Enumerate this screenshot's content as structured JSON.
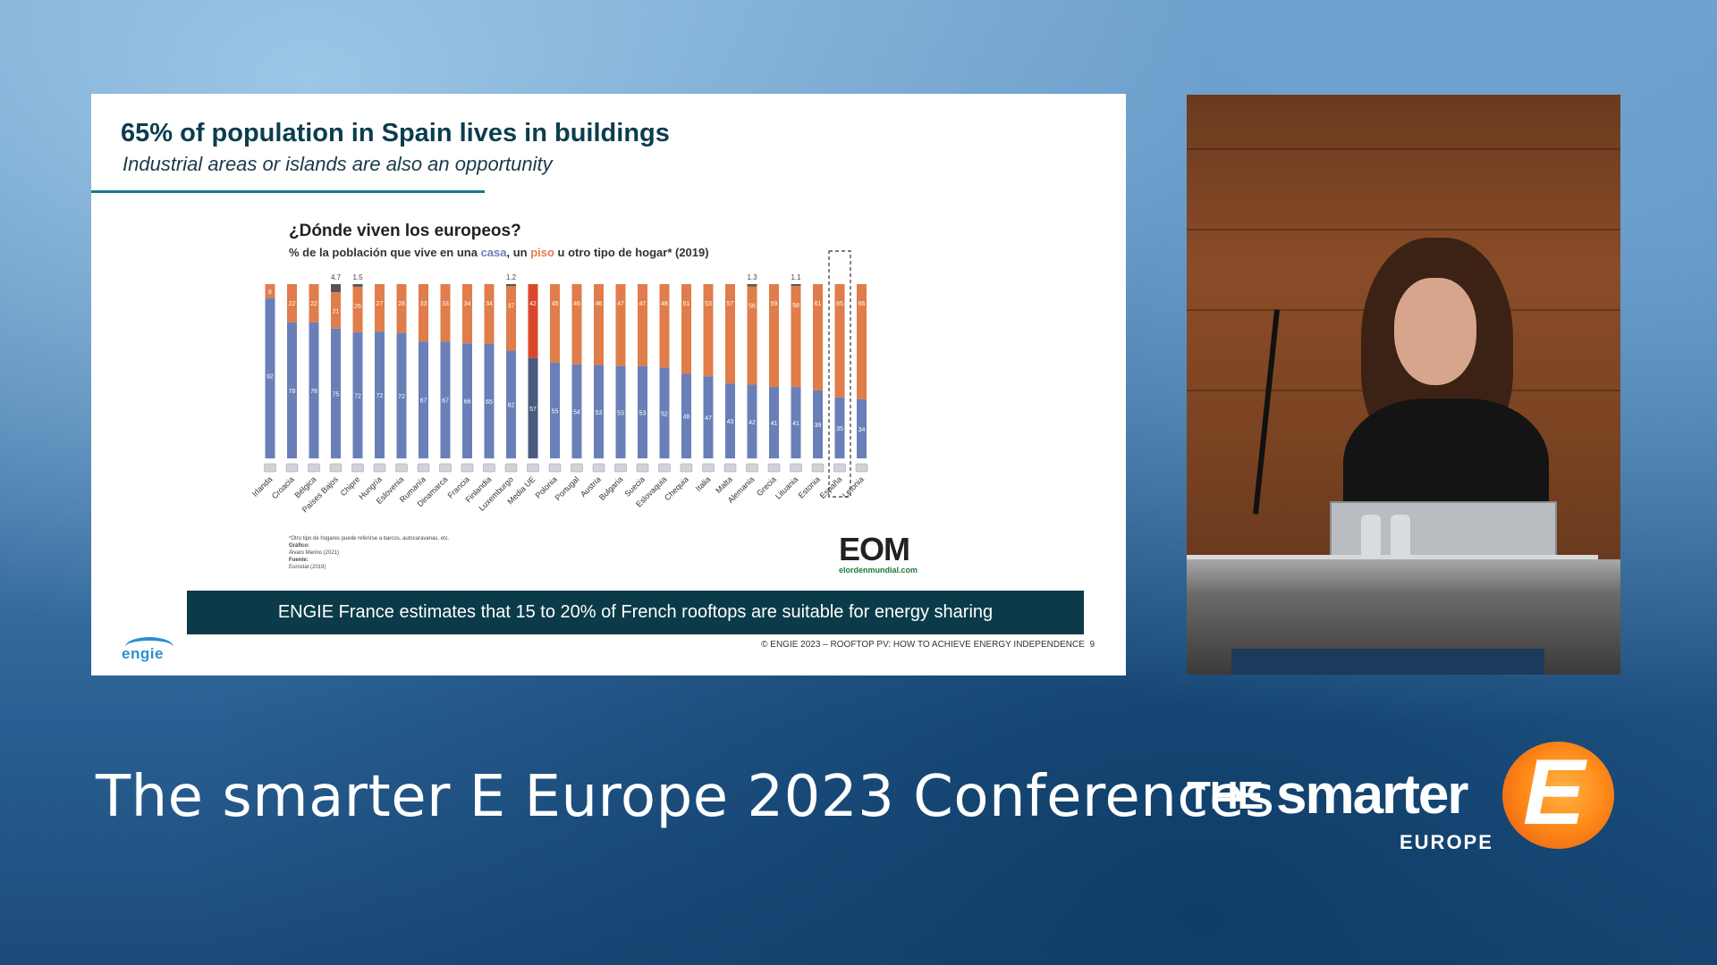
{
  "slide": {
    "title": "65% of population in Spain lives in buildings",
    "subtitle": "Industrial areas or islands are also an opportunity",
    "chart_heading": "¿Dónde viven los europeos?",
    "chart_sub_prefix": "% de la población que vive en una ",
    "chart_sub_casa": "casa",
    "chart_sub_mid": ", un ",
    "chart_sub_piso": "piso",
    "chart_sub_suffix": " u otro tipo de hogar* (2019)",
    "footnote": "*Otro tipo de hogares puede referirse a barcos, autocaravanas, etc.",
    "grafico_label": "Gráfico:",
    "grafico_value": "Álvaro Merino (2021)",
    "fuente_label": "Fuente:",
    "fuente_value": "Eurostat (2019)",
    "eom_logo": "EOM",
    "eom_domain": "elordenmundial.com",
    "banner": "ENGIE France estimates that 15 to 20% of French rooftops are suitable for energy sharing",
    "logo": "engie",
    "copyright": "© ENGIE 2023 – ROOFTOP PV: HOW TO ACHIEVE ENERGY INDEPENDENCE",
    "page_number": "9"
  },
  "colors": {
    "casa": "#6a7fb7",
    "piso": "#e07d4a",
    "other": "#555555",
    "eu_casa": "#4a5a7e",
    "eu_piso": "#d9472b",
    "banner": "#0b3b48"
  },
  "chart_data": {
    "type": "bar",
    "stacked": true,
    "categories": [
      "Irlanda",
      "Croacia",
      "Bélgica",
      "Países Bajos",
      "Chipre",
      "Hungría",
      "Eslovenia",
      "Rumanía",
      "Dinamarca",
      "Francia",
      "Finlandia",
      "Luxemburgo",
      "Media UE",
      "Polonia",
      "Portugal",
      "Austria",
      "Bulgaria",
      "Suecia",
      "Eslovaquia",
      "Chequia",
      "Italia",
      "Malta",
      "Alemania",
      "Grecia",
      "Lituania",
      "Estonia",
      "España",
      "Letonia"
    ],
    "series": [
      {
        "name": "casa",
        "values": [
          92,
          78,
          78,
          75,
          72,
          72,
          72,
          67,
          67,
          66,
          65,
          62,
          57,
          55,
          54,
          53,
          53,
          53,
          52,
          48,
          47,
          43,
          42,
          41,
          41,
          39,
          35,
          34
        ]
      },
      {
        "name": "piso",
        "values": [
          8,
          22,
          22,
          21,
          26,
          27,
          28,
          33,
          33,
          34,
          34,
          37,
          42,
          45,
          46,
          46,
          47,
          47,
          48,
          51,
          53,
          57,
          56,
          59,
          58,
          61,
          65,
          66
        ]
      },
      {
        "name": "otro",
        "values": [
          0,
          0,
          0,
          4.7,
          1.5,
          0,
          0,
          0,
          0,
          0,
          0,
          1.2,
          0,
          0,
          0,
          0,
          0,
          0,
          0,
          0,
          0,
          0,
          1.3,
          0,
          1.1,
          0,
          0,
          0
        ]
      }
    ],
    "top_labels": [
      "",
      "",
      "",
      "4.7",
      "1.5",
      "",
      "",
      "",
      "",
      "",
      "",
      "1.2",
      "",
      "",
      "",
      "",
      "",
      "",
      "",
      "",
      "",
      "",
      "1.3",
      "",
      "1.1",
      "",
      "",
      ""
    ],
    "highlight": "España",
    "ylim": [
      0,
      100
    ]
  },
  "presentation": {
    "conference_title": "The smarter E Europe 2023 Conferences",
    "brand_the": "THE",
    "brand_smarter": "smarter",
    "brand_europe": "EUROPE",
    "brand_e": "E"
  }
}
